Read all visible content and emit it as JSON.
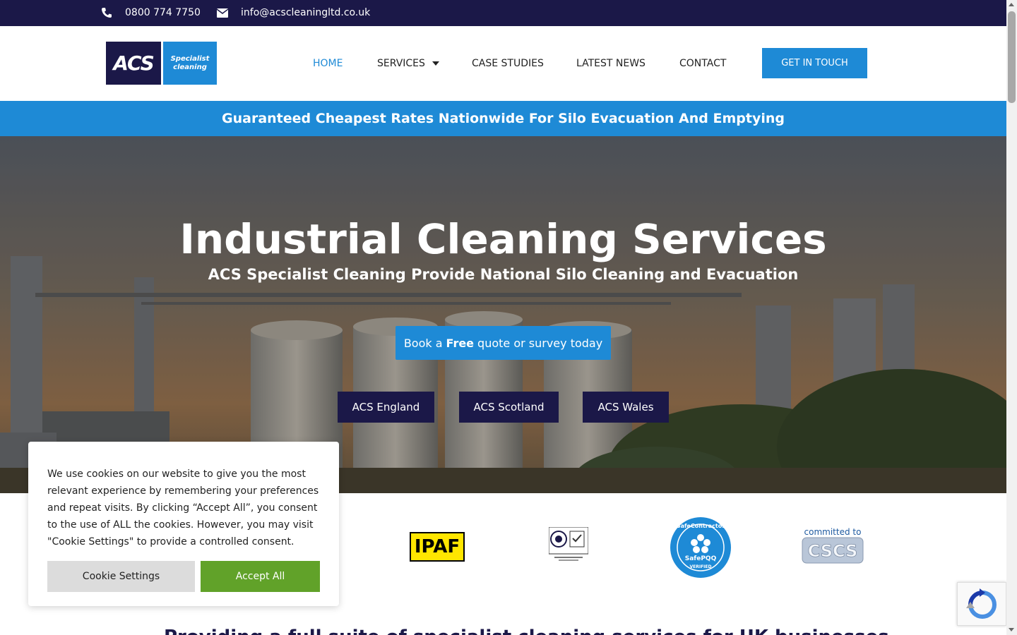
{
  "topbar": {
    "phone": "0800 774 7750",
    "email": "info@acscleaningltd.co.uk",
    "icons": [
      "phone-icon",
      "envelope-icon"
    ]
  },
  "logo": {
    "main": "ACS",
    "tag_line1": "Specialist",
    "tag_line2": "cleaning"
  },
  "nav": {
    "items": [
      {
        "label": "HOME",
        "active": true
      },
      {
        "label": "SERVICES",
        "has_dropdown": true
      },
      {
        "label": "CASE STUDIES"
      },
      {
        "label": "LATEST NEWS"
      },
      {
        "label": "CONTACT"
      }
    ],
    "cta": "GET IN TOUCH"
  },
  "banner": {
    "text": "Guaranteed Cheapest Rates Nationwide For Silo Evacuation And Emptying"
  },
  "hero": {
    "title": "Industrial Cleaning Services",
    "subtitle": "ACS Specialist Cleaning Provide National Silo Cleaning and Evacuation",
    "quote_pre": "Book a",
    "quote_bold": "Free",
    "quote_post": "quote or survey today",
    "regions": [
      "ACS England",
      "ACS Scotland",
      "ACS Wales"
    ]
  },
  "accreditations": {
    "ipaf": "IPAF",
    "safecontractor_top": "SafeContractor",
    "safecontractor_mid": "SafePQQ",
    "safecontractor_bottom": "VERIFIED",
    "cscs_top": "committed to",
    "cscs": "CSCS"
  },
  "section_heading": "Providing a full suite of specialist cleaning services for UK businesses",
  "cookie": {
    "text": "We use cookies on our website to give you the most relevant experience by remembering your preferences and repeat visits. By clicking “Accept All”, you consent to the use of ALL the cookies. However, you may visit \"Cookie Settings\" to provide a controlled consent.",
    "settings_label": "Cookie Settings",
    "accept_label": "Accept All"
  },
  "colors": {
    "navy": "#1b1848",
    "blue": "#1e8ad6",
    "green": "#61a229"
  }
}
